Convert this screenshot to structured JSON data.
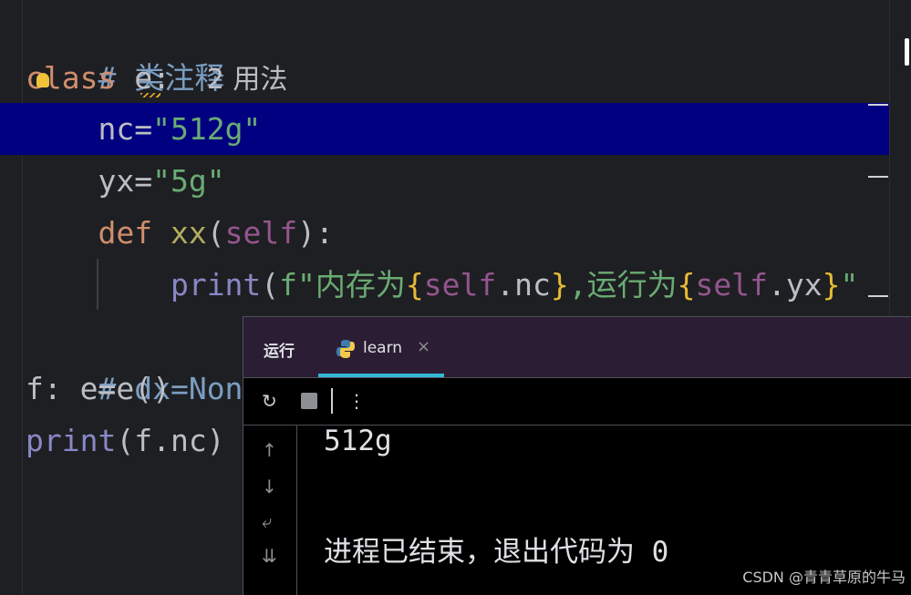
{
  "editor": {
    "line1_comment": "# 类注释",
    "line2_class_kw_a": "c",
    "line2_class_kw_b": "lass",
    "line2_name": "e",
    "line2_colon": ":",
    "line2_hint": "2 用法",
    "line3_var": "nc=",
    "line3_value": "\"512g\"",
    "line4_var": "yx=",
    "line4_value": "\"5g\"",
    "line5_def": "def",
    "line5_fn": "xx",
    "line5_open": "(",
    "line5_self": "self",
    "line5_close": "):",
    "line6_print": "print",
    "line6_open": "(",
    "line6_fstr_start": "f\"内存为",
    "line6_brace_open1": "{",
    "line6_self1": "self",
    "line6_attr1": ".nc",
    "line6_brace_close1": "}",
    "line6_mid": ",运行为",
    "line6_brace_open2": "{",
    "line6_self2": "self",
    "line6_attr2": ".yx",
    "line6_brace_close2": "}",
    "line6_tail": "\"",
    "line7_comment": "# dx=None",
    "line8_code": "f: e=e()",
    "line9_print": "print",
    "line9_rest": "(f.nc)"
  },
  "run_panel": {
    "title": "运行",
    "tab_label": "learn",
    "tab_close": "×",
    "output_line1": "512g",
    "output_line2": "进程已结束，退出代码为 0"
  },
  "icons": {
    "rerun": "↻",
    "more": "⋮",
    "up": "↑",
    "down": "↓",
    "wrap": "⤶",
    "scroll_end": "⇊"
  },
  "watermark": "CSDN @青青草原的牛马",
  "colors": {
    "highlight": "#000080",
    "tab_accent": "#35b8d8",
    "panel_header": "#2b1d33"
  }
}
